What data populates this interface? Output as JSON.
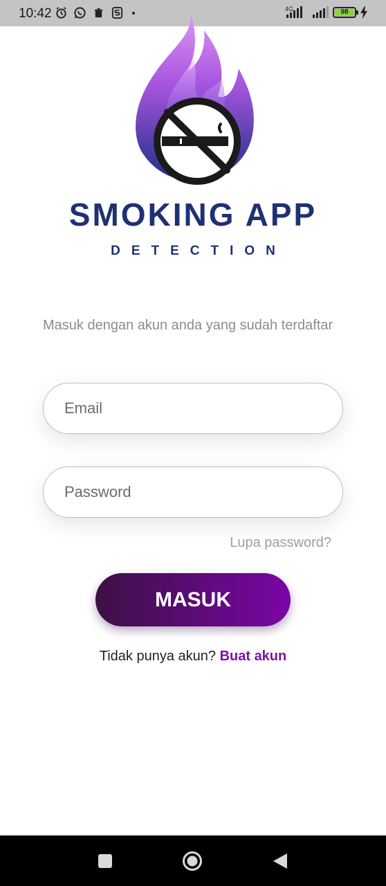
{
  "status_bar": {
    "time": "10:42",
    "network": "4G",
    "battery": "98",
    "icons": [
      "alarm-icon",
      "whatsapp-icon",
      "trash-icon",
      "s-app-icon",
      "signal-icon",
      "charging-icon"
    ]
  },
  "brand": {
    "title": "SMOKING APP",
    "subtitle": "DETECTION",
    "colors": {
      "primary": "#1f3173",
      "flame_top": "#d58cf0",
      "flame_bottom": "#1d2f86"
    }
  },
  "login": {
    "intro": "Masuk dengan akun anda yang sudah terdaftar",
    "email_placeholder": "Email",
    "password_placeholder": "Password",
    "forgot_label": "Lupa password?",
    "submit_label": "MASUK",
    "signup_prompt": "Tidak punya akun?",
    "signup_link": "Buat akun",
    "accent": "#7a05a6"
  },
  "nav_bar": {
    "buttons": [
      "recent-apps-icon",
      "home-icon",
      "back-icon"
    ]
  }
}
